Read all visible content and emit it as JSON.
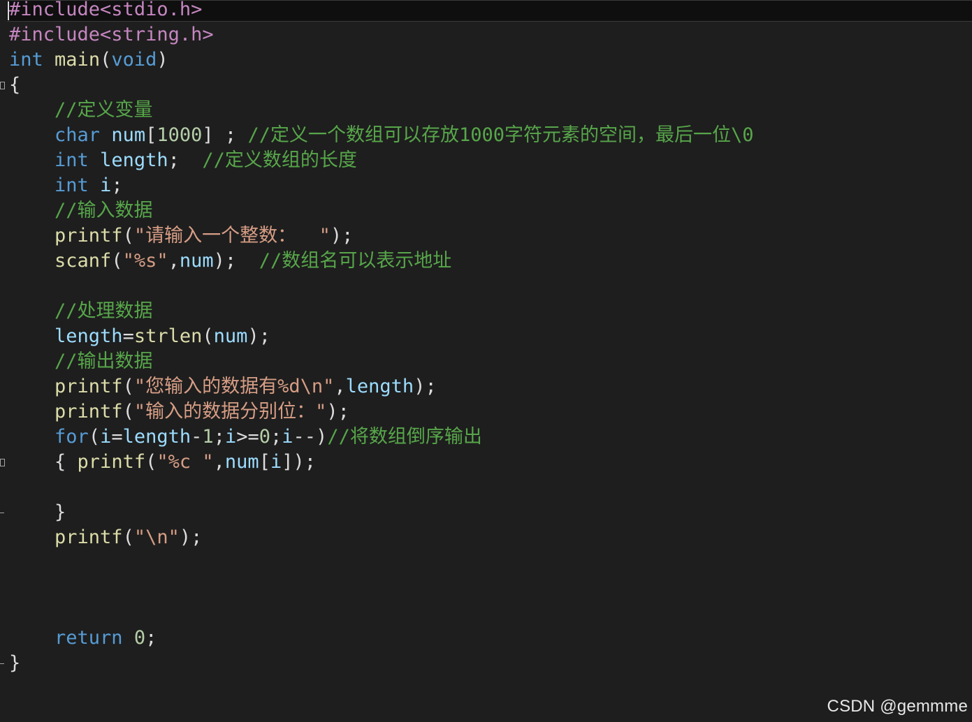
{
  "editor": {
    "language": "c",
    "theme_colors": {
      "background": "#1e1e1e",
      "preprocessor": "#c586c0",
      "keyword": "#569cd6",
      "function": "#dcdcaa",
      "variable": "#9cdcfe",
      "number": "#b5cea8",
      "string": "#d69d85",
      "comment": "#57a64a"
    },
    "lines": [
      {
        "tokens": [
          {
            "t": "#include",
            "c": "pre"
          },
          {
            "t": "<stdio.h>",
            "c": "pre"
          }
        ]
      },
      {
        "tokens": [
          {
            "t": "#include",
            "c": "pre"
          },
          {
            "t": "<string.h>",
            "c": "pre"
          }
        ]
      },
      {
        "tokens": [
          {
            "t": "int",
            "c": "kw"
          },
          {
            "t": " ",
            "c": "plain"
          },
          {
            "t": "main",
            "c": "fn"
          },
          {
            "t": "(",
            "c": "punc"
          },
          {
            "t": "void",
            "c": "kw"
          },
          {
            "t": ")",
            "c": "punc"
          }
        ]
      },
      {
        "tokens": [
          {
            "t": "{",
            "c": "punc"
          }
        ]
      },
      {
        "tokens": [
          {
            "t": "    ",
            "c": "plain"
          },
          {
            "t": "//定义变量",
            "c": "cmt"
          }
        ]
      },
      {
        "tokens": [
          {
            "t": "    ",
            "c": "plain"
          },
          {
            "t": "char",
            "c": "kw"
          },
          {
            "t": " ",
            "c": "plain"
          },
          {
            "t": "num",
            "c": "var"
          },
          {
            "t": "[",
            "c": "punc"
          },
          {
            "t": "1000",
            "c": "num"
          },
          {
            "t": "] ; ",
            "c": "punc"
          },
          {
            "t": "//定义一个数组可以存放1000字符元素的空间，最后一位\\0",
            "c": "cmt"
          }
        ]
      },
      {
        "tokens": [
          {
            "t": "    ",
            "c": "plain"
          },
          {
            "t": "int",
            "c": "kw"
          },
          {
            "t": " ",
            "c": "plain"
          },
          {
            "t": "length",
            "c": "var"
          },
          {
            "t": ";  ",
            "c": "punc"
          },
          {
            "t": "//定义数组的长度",
            "c": "cmt"
          }
        ]
      },
      {
        "tokens": [
          {
            "t": "    ",
            "c": "plain"
          },
          {
            "t": "int",
            "c": "kw"
          },
          {
            "t": " ",
            "c": "plain"
          },
          {
            "t": "i",
            "c": "var"
          },
          {
            "t": ";",
            "c": "punc"
          }
        ]
      },
      {
        "tokens": [
          {
            "t": "    ",
            "c": "plain"
          },
          {
            "t": "//输入数据",
            "c": "cmt"
          }
        ]
      },
      {
        "tokens": [
          {
            "t": "    ",
            "c": "plain"
          },
          {
            "t": "printf",
            "c": "fn"
          },
          {
            "t": "(",
            "c": "punc"
          },
          {
            "t": "\"请输入一个整数：  \"",
            "c": "str"
          },
          {
            "t": ");",
            "c": "punc"
          }
        ]
      },
      {
        "tokens": [
          {
            "t": "    ",
            "c": "plain"
          },
          {
            "t": "scanf",
            "c": "fn"
          },
          {
            "t": "(",
            "c": "punc"
          },
          {
            "t": "\"%s\"",
            "c": "str"
          },
          {
            "t": ",",
            "c": "punc"
          },
          {
            "t": "num",
            "c": "var"
          },
          {
            "t": ");  ",
            "c": "punc"
          },
          {
            "t": "//数组名可以表示地址",
            "c": "cmt"
          }
        ]
      },
      {
        "tokens": []
      },
      {
        "tokens": [
          {
            "t": "    ",
            "c": "plain"
          },
          {
            "t": "//处理数据",
            "c": "cmt"
          }
        ]
      },
      {
        "tokens": [
          {
            "t": "    ",
            "c": "plain"
          },
          {
            "t": "length",
            "c": "var"
          },
          {
            "t": "=",
            "c": "punc"
          },
          {
            "t": "strlen",
            "c": "fn"
          },
          {
            "t": "(",
            "c": "punc"
          },
          {
            "t": "num",
            "c": "var"
          },
          {
            "t": ");",
            "c": "punc"
          }
        ]
      },
      {
        "tokens": [
          {
            "t": "    ",
            "c": "plain"
          },
          {
            "t": "//输出数据",
            "c": "cmt"
          }
        ]
      },
      {
        "tokens": [
          {
            "t": "    ",
            "c": "plain"
          },
          {
            "t": "printf",
            "c": "fn"
          },
          {
            "t": "(",
            "c": "punc"
          },
          {
            "t": "\"您输入的数据有%d\\n\"",
            "c": "str"
          },
          {
            "t": ",",
            "c": "punc"
          },
          {
            "t": "length",
            "c": "var"
          },
          {
            "t": ");",
            "c": "punc"
          }
        ]
      },
      {
        "tokens": [
          {
            "t": "    ",
            "c": "plain"
          },
          {
            "t": "printf",
            "c": "fn"
          },
          {
            "t": "(",
            "c": "punc"
          },
          {
            "t": "\"输入的数据分别位：\"",
            "c": "str"
          },
          {
            "t": ");",
            "c": "punc"
          }
        ]
      },
      {
        "tokens": [
          {
            "t": "    ",
            "c": "plain"
          },
          {
            "t": "for",
            "c": "kw"
          },
          {
            "t": "(",
            "c": "punc"
          },
          {
            "t": "i",
            "c": "var"
          },
          {
            "t": "=",
            "c": "punc"
          },
          {
            "t": "length",
            "c": "var"
          },
          {
            "t": "-",
            "c": "punc"
          },
          {
            "t": "1",
            "c": "num"
          },
          {
            "t": ";",
            "c": "punc"
          },
          {
            "t": "i",
            "c": "var"
          },
          {
            "t": ">=",
            "c": "punc"
          },
          {
            "t": "0",
            "c": "num"
          },
          {
            "t": ";",
            "c": "punc"
          },
          {
            "t": "i",
            "c": "var"
          },
          {
            "t": "--)",
            "c": "punc"
          },
          {
            "t": "//将数组倒序输出",
            "c": "cmt"
          }
        ]
      },
      {
        "tokens": [
          {
            "t": "    ",
            "c": "plain"
          },
          {
            "t": "{ ",
            "c": "punc"
          },
          {
            "t": "printf",
            "c": "fn"
          },
          {
            "t": "(",
            "c": "punc"
          },
          {
            "t": "\"%c \"",
            "c": "str"
          },
          {
            "t": ",",
            "c": "punc"
          },
          {
            "t": "num",
            "c": "var"
          },
          {
            "t": "[",
            "c": "punc"
          },
          {
            "t": "i",
            "c": "var"
          },
          {
            "t": "]);",
            "c": "punc"
          }
        ]
      },
      {
        "tokens": []
      },
      {
        "tokens": [
          {
            "t": "    ",
            "c": "plain"
          },
          {
            "t": "}",
            "c": "punc"
          }
        ]
      },
      {
        "tokens": [
          {
            "t": "    ",
            "c": "plain"
          },
          {
            "t": "printf",
            "c": "fn"
          },
          {
            "t": "(",
            "c": "punc"
          },
          {
            "t": "\"\\n\"",
            "c": "str"
          },
          {
            "t": ");",
            "c": "punc"
          }
        ]
      },
      {
        "tokens": []
      },
      {
        "tokens": []
      },
      {
        "tokens": []
      },
      {
        "tokens": [
          {
            "t": "    ",
            "c": "plain"
          },
          {
            "t": "return",
            "c": "kw"
          },
          {
            "t": " ",
            "c": "plain"
          },
          {
            "t": "0",
            "c": "num"
          },
          {
            "t": ";",
            "c": "punc"
          }
        ]
      },
      {
        "tokens": [
          {
            "t": "}",
            "c": "punc"
          }
        ]
      }
    ],
    "fold_markers": [
      {
        "line": 4,
        "type": "open"
      },
      {
        "line": 19,
        "type": "open"
      },
      {
        "line": 21,
        "type": "end"
      },
      {
        "line": 27,
        "type": "end"
      }
    ]
  },
  "watermark": {
    "text": "CSDN @gemmme"
  }
}
